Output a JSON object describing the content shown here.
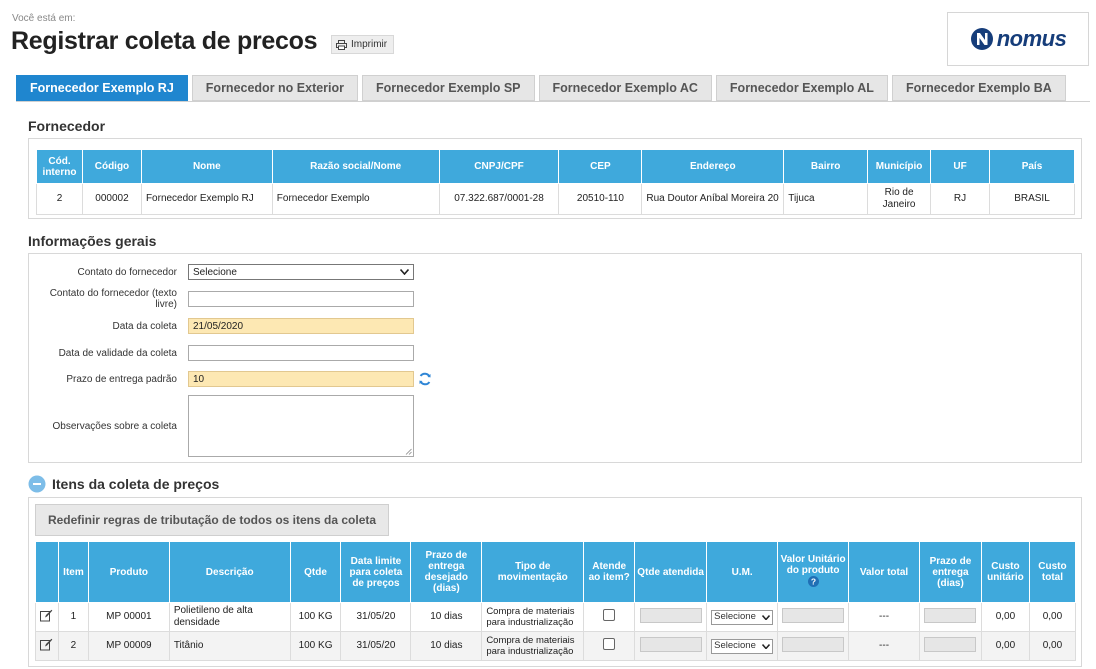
{
  "breadcrumb": "Você está em:",
  "title": "Registrar coleta de precos",
  "print_label": "Imprimir",
  "logo_text": "nomus",
  "tabs": [
    "Fornecedor Exemplo RJ",
    "Fornecedor no Exterior",
    "Fornecedor Exemplo SP",
    "Fornecedor Exemplo AC",
    "Fornecedor Exemplo AL",
    "Fornecedor Exemplo BA"
  ],
  "supplier": {
    "section_title": "Fornecedor",
    "headers": [
      "Cód. interno",
      "Código",
      "Nome",
      "Razão social/Nome",
      "CNPJ/CPF",
      "CEP",
      "Endereço",
      "Bairro",
      "Município",
      "UF",
      "País"
    ],
    "row": [
      "2",
      "000002",
      "Fornecedor Exemplo RJ",
      "Fornecedor Exemplo",
      "07.322.687/0001-28",
      "20510-110",
      "Rua Doutor Aníbal Moreira 20",
      "Tijuca",
      "Rio de Janeiro",
      "RJ",
      "BRASIL"
    ]
  },
  "general": {
    "section_title": "Informações gerais",
    "contato_label": "Contato do fornecedor",
    "contato_value": "Selecione",
    "contato_livre_label": "Contato do fornecedor (texto livre)",
    "contato_livre_value": "",
    "data_label": "Data da coleta",
    "data_value": "21/05/2020",
    "validade_label": "Data de validade da coleta",
    "validade_value": "",
    "prazo_label": "Prazo de entrega padrão",
    "prazo_value": "10",
    "obs_label": "Observações sobre a coleta",
    "obs_value": ""
  },
  "items": {
    "section_title": "Itens da coleta de preços",
    "redefine_label": "Redefinir regras de tributação de todos os itens da coleta",
    "headers": [
      "",
      "Item",
      "Produto",
      "Descrição",
      "Qtde",
      "Data limite para coleta de preços",
      "Prazo de entrega desejado (dias)",
      "Tipo de movimentação",
      "Atende ao item?",
      "Qtde atendida",
      "U.M.",
      "Valor Unitário do produto",
      "Valor total",
      "Prazo de entrega (dias)",
      "Custo unitário",
      "Custo total"
    ],
    "rows": [
      {
        "item": "1",
        "produto": "MP 00001",
        "descricao": "Polietileno de alta densidade",
        "qtde": "100 KG",
        "data_limite": "31/05/20",
        "prazo": "10 dias",
        "tipo": "Compra de materiais para industrialização",
        "um": "Selecione",
        "valor_total": "---",
        "custo_unit": "0,00",
        "custo_total": "0,00"
      },
      {
        "item": "2",
        "produto": "MP 00009",
        "descricao": "Titânio",
        "qtde": "100 KG",
        "data_limite": "31/05/20",
        "prazo": "10 dias",
        "tipo": "Compra de materiais para industrialização",
        "um": "Selecione",
        "valor_total": "---",
        "custo_unit": "0,00",
        "custo_total": "0,00"
      }
    ]
  },
  "colors": {
    "accent": "#1f86cf",
    "table_header": "#3fa9dc",
    "required_field": "#fde8b3",
    "refresh_icon": "#2f86d6"
  }
}
